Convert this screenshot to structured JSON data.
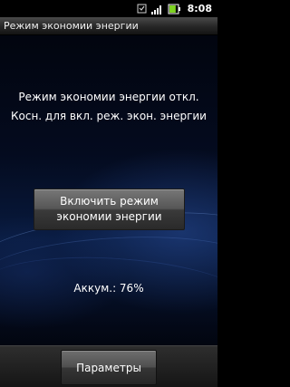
{
  "status_bar": {
    "time": "8:08",
    "icons": [
      "usb-debug-icon",
      "signal-icon",
      "battery-icon"
    ]
  },
  "title_bar": {
    "title": "Режим экономии энергии"
  },
  "main": {
    "info_line1": "Режим экономии энергии откл.",
    "info_line2": "Косн. для вкл. реж. экон. энергии",
    "toggle_line1": "Включить режим",
    "toggle_line2": "экономии энергии",
    "battery_text": "Аккум.: 76%",
    "battery_percent": 76
  },
  "bottom_bar": {
    "settings_label": "Параметры"
  },
  "colors": {
    "background_accent": "#081a3e",
    "battery_fill": "#7ed321"
  }
}
